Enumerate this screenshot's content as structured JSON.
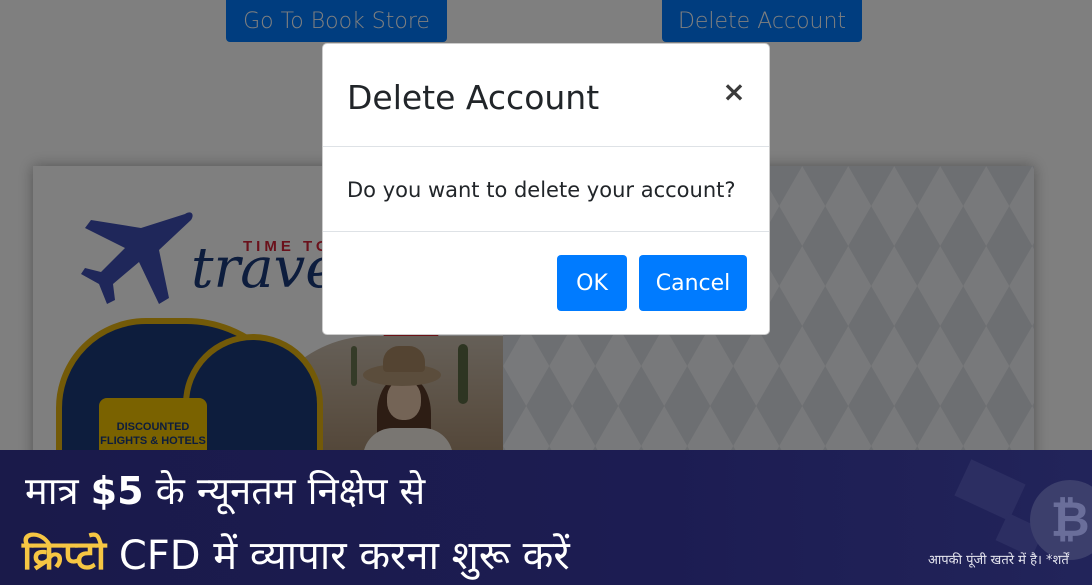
{
  "page": {
    "go_to_book_store_label": "Go To Book Store",
    "delete_account_label": "Delete Account"
  },
  "ad_card": {
    "headline_small": "TIME TO",
    "headline_script": "travel",
    "badge_text": "DISCOUNTED FLIGHTS & HOTELS"
  },
  "modal": {
    "title": "Delete Account",
    "close_symbol": "×",
    "message": "Do you want to delete your account?",
    "ok_label": "OK",
    "cancel_label": "Cancel"
  },
  "banner": {
    "line1_prefix": "मात्र ",
    "line1_amount": "$5",
    "line1_suffix": " के न्यूनतम निक्षेप से",
    "line2_highlight": "क्रिप्टो",
    "line2_rest": " CFD में  व्यापार करना शुरू करें",
    "risk_note": "आपकी पूंजी खतरे में है। *शर्तें",
    "coin_symbol": "₿"
  },
  "colors": {
    "primary": "#007bff",
    "banner_bg": "#1a1a4a",
    "banner_accent": "#f6c643",
    "overlay": "rgba(0,0,0,0.5)"
  }
}
